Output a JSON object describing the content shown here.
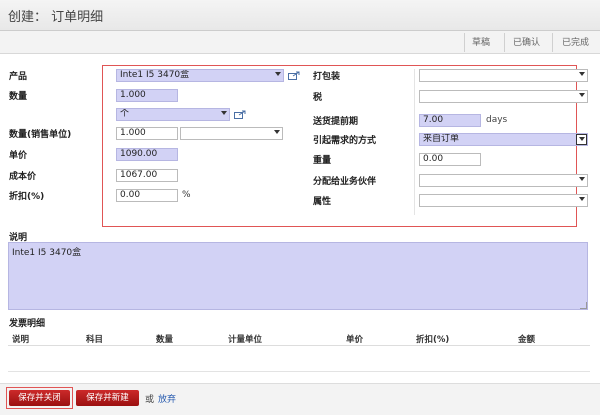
{
  "header": {
    "title": "创建： 订单明细"
  },
  "stages": [
    "草稿",
    "已确认",
    "已完成"
  ],
  "left": {
    "product": {
      "label": "产品",
      "value": "Inte1 I5 3470盒"
    },
    "qty": {
      "label": "数量",
      "value": "1.000",
      "uom": "个"
    },
    "sale_qty": {
      "label": "数量(销售单位)",
      "value": "1.000",
      "uom": ""
    },
    "price": {
      "label": "单价",
      "value": "1090.00"
    },
    "cost": {
      "label": "成本价",
      "value": "1067.00"
    },
    "discount": {
      "label": "折扣(%)",
      "value": "0.00",
      "unit": "%"
    }
  },
  "right": {
    "packaging": {
      "label": "打包装",
      "value": ""
    },
    "tax": {
      "label": "税",
      "value": ""
    },
    "lead": {
      "label": "送货提前期",
      "value": "7.00",
      "unit": "days"
    },
    "procure": {
      "label": "引起需求的方式",
      "value": "来自订单"
    },
    "weight": {
      "label": "重量",
      "value": "0.00"
    },
    "partner": {
      "label": "分配给业务伙伴",
      "value": ""
    },
    "attr": {
      "label": "属性",
      "value": ""
    }
  },
  "description": {
    "label": "说明",
    "value": "Inte1 I5 3470盒"
  },
  "invoice": {
    "title": "发票明细",
    "columns": [
      "说明",
      "科目",
      "数量",
      "计量单位",
      "单价",
      "折扣(%)",
      "金额"
    ]
  },
  "footer": {
    "save_close": "保存并关闭",
    "save_new": "保存并新建",
    "or": "或",
    "discard": "放弃"
  }
}
